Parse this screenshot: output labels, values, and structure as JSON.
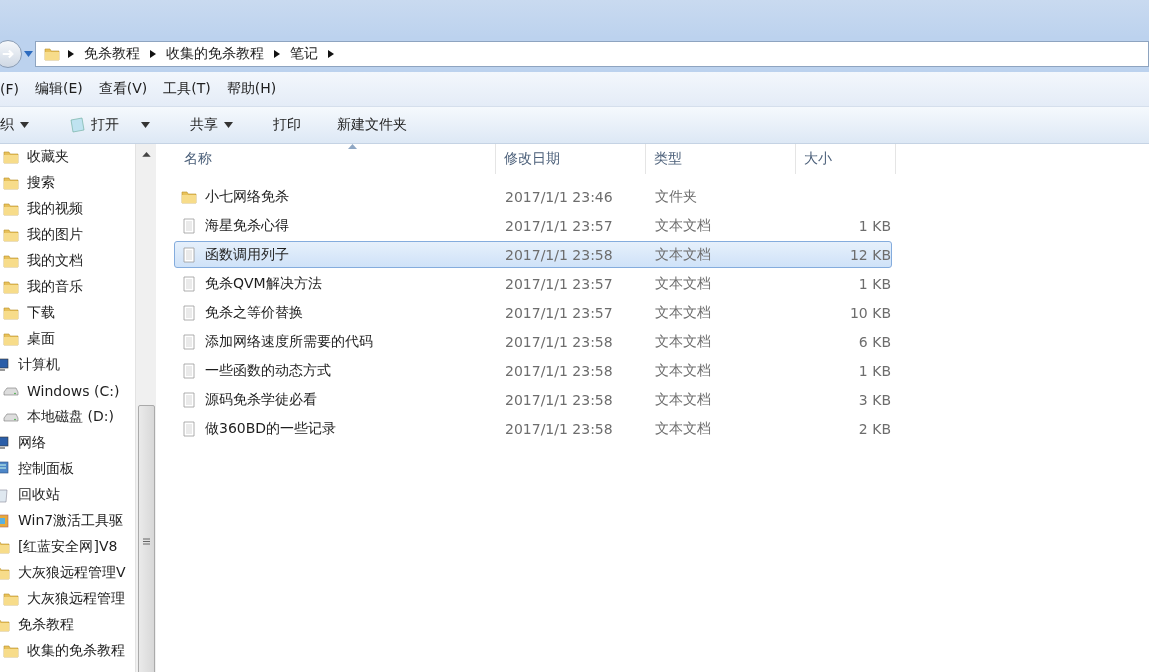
{
  "address_bar": {
    "crumbs": [
      "免杀教程",
      "收集的免杀教程",
      "笔记"
    ]
  },
  "menu_bar": [
    "(F)",
    "编辑(E)",
    "查看(V)",
    "工具(T)",
    "帮助(H)"
  ],
  "toolbar": [
    {
      "label": "织",
      "kind": "dropdown"
    },
    {
      "label": "打开",
      "kind": "open"
    },
    {
      "label": "共享",
      "kind": "dropdown"
    },
    {
      "label": "打印",
      "kind": "plain"
    },
    {
      "label": "新建文件夹",
      "kind": "plain"
    }
  ],
  "sidebar": {
    "favorites": [
      {
        "label": "收藏夹",
        "kind": "folder"
      },
      {
        "label": "搜索",
        "kind": "folder"
      },
      {
        "label": "我的视频",
        "kind": "folder"
      },
      {
        "label": "我的图片",
        "kind": "folder"
      },
      {
        "label": "我的文档",
        "kind": "folder"
      },
      {
        "label": "我的音乐",
        "kind": "folder"
      },
      {
        "label": "下载",
        "kind": "folder"
      },
      {
        "label": "桌面",
        "kind": "folder"
      }
    ],
    "items": [
      {
        "label": "计算机",
        "kind": "computer",
        "children": [
          {
            "label": "Windows (C:)",
            "kind": "drive"
          },
          {
            "label": "本地磁盘 (D:)",
            "kind": "drive"
          }
        ]
      },
      {
        "label": "网络",
        "kind": "computer"
      },
      {
        "label": "控制面板",
        "kind": "panel"
      },
      {
        "label": "回收站",
        "kind": "bin"
      },
      {
        "label": "Win7激活工具驱",
        "kind": "app"
      },
      {
        "label": "[红蓝安全网]V8",
        "kind": "folder"
      },
      {
        "label": "大灰狼远程管理V",
        "kind": "folder",
        "children": [
          {
            "label": "大灰狼远程管理",
            "kind": "folder"
          }
        ]
      },
      {
        "label": "免杀教程",
        "kind": "folder",
        "children": [
          {
            "label": "收集的免杀教程",
            "kind": "folder"
          }
        ]
      }
    ]
  },
  "table": {
    "columns": [
      "名称",
      "修改日期",
      "类型",
      "大小"
    ],
    "rows": [
      {
        "name": "小七网络免杀",
        "date": "2017/1/1 23:46",
        "type": "文件夹",
        "kind": "folder",
        "selected": false
      },
      {
        "name": "海星免杀心得",
        "date": "2017/1/1 23:57",
        "type": "文本文档",
        "size": "1 KB",
        "kind": "text",
        "selected": false
      },
      {
        "name": "函数调用列子",
        "date": "2017/1/1 23:58",
        "type": "文本文档",
        "size": "12 KB",
        "kind": "text",
        "selected": true
      },
      {
        "name": "免杀QVM解决方法",
        "date": "2017/1/1 23:57",
        "type": "文本文档",
        "size": "1 KB",
        "kind": "text",
        "selected": false
      },
      {
        "name": "免杀之等价替换",
        "date": "2017/1/1 23:57",
        "type": "文本文档",
        "size": "10 KB",
        "kind": "text",
        "selected": false
      },
      {
        "name": "添加网络速度所需要的代码",
        "date": "2017/1/1 23:58",
        "type": "文本文档",
        "size": "6 KB",
        "kind": "text",
        "selected": false
      },
      {
        "name": "一些函数的动态方式",
        "date": "2017/1/1 23:58",
        "type": "文本文档",
        "size": "1 KB",
        "kind": "text",
        "selected": false
      },
      {
        "name": "源码免杀学徒必看",
        "date": "2017/1/1 23:58",
        "type": "文本文档",
        "size": "3 KB",
        "kind": "text",
        "selected": false
      },
      {
        "name": "做360BD的一些记录",
        "date": "2017/1/1 23:58",
        "type": "文本文档",
        "size": "2 KB",
        "kind": "text",
        "selected": false
      }
    ]
  }
}
